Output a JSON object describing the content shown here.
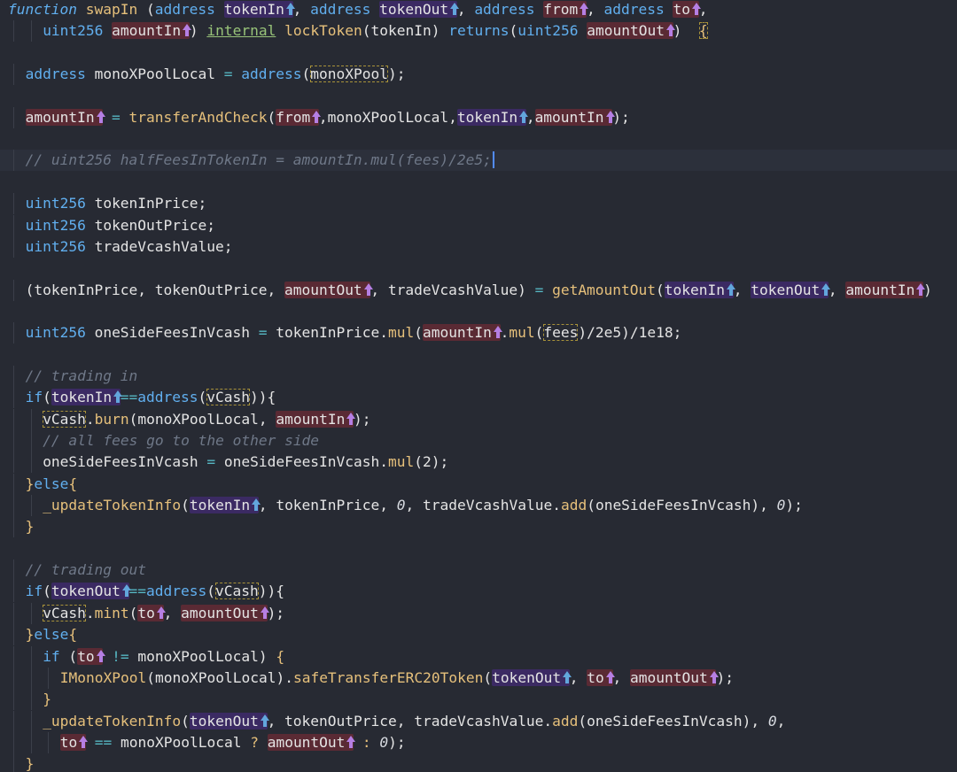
{
  "editor": {
    "lines": [
      {
        "spans": [
          {
            "t": "function",
            "c": "fnkw"
          },
          {
            "t": " "
          },
          {
            "t": "swapIn",
            "c": "fn"
          },
          {
            "t": " ("
          },
          {
            "t": "address",
            "c": "kw"
          },
          {
            "t": " "
          },
          {
            "t": "tokenIn",
            "bg": "pt",
            "a": "b"
          },
          {
            "t": ", "
          },
          {
            "t": "address",
            "c": "kw"
          },
          {
            "t": " "
          },
          {
            "t": "tokenOut",
            "bg": "pt",
            "a": "b"
          },
          {
            "t": ", "
          },
          {
            "t": "address",
            "c": "kw"
          },
          {
            "t": " "
          },
          {
            "t": "from",
            "bg": "pr",
            "a": "p"
          },
          {
            "t": ", "
          },
          {
            "t": "address",
            "c": "kw"
          },
          {
            "t": " "
          },
          {
            "t": "to",
            "bg": "pr",
            "a": "p"
          },
          {
            "t": ","
          }
        ]
      },
      {
        "indent": 2,
        "spans": [
          {
            "t": "uint256",
            "c": "kw"
          },
          {
            "t": " "
          },
          {
            "t": "amountIn",
            "bg": "pr",
            "a": "p"
          },
          {
            "t": ") "
          },
          {
            "t": "internal",
            "c": "vis"
          },
          {
            "t": " "
          },
          {
            "t": "lockToken",
            "c": "fn"
          },
          {
            "t": "(tokenIn) "
          },
          {
            "t": "returns",
            "c": "kw"
          },
          {
            "t": "("
          },
          {
            "t": "uint256",
            "c": "kw"
          },
          {
            "t": " "
          },
          {
            "t": "amountOut",
            "bg": "pr",
            "a": "p"
          },
          {
            "t": ")  "
          },
          {
            "t": "{",
            "c": "fn",
            "box": true
          }
        ]
      },
      {
        "spans": []
      },
      {
        "indent": 1,
        "spans": [
          {
            "t": "address",
            "c": "kw"
          },
          {
            "t": " monoXPoolLocal "
          },
          {
            "t": "=",
            "c": "op"
          },
          {
            "t": " "
          },
          {
            "t": "address",
            "c": "kw"
          },
          {
            "t": "("
          },
          {
            "t": "monoXPool",
            "box": true
          },
          {
            "t": ");"
          }
        ]
      },
      {
        "spans": []
      },
      {
        "indent": 1,
        "spans": [
          {
            "t": "amountIn",
            "bg": "pr",
            "a": "p"
          },
          {
            "t": " "
          },
          {
            "t": "=",
            "c": "op"
          },
          {
            "t": " "
          },
          {
            "t": "transferAndCheck",
            "c": "fn"
          },
          {
            "t": "("
          },
          {
            "t": "from",
            "bg": "pr",
            "a": "p"
          },
          {
            "t": ",monoXPoolLocal,"
          },
          {
            "t": "tokenIn",
            "bg": "pt",
            "a": "b"
          },
          {
            "t": ","
          },
          {
            "t": "amountIn",
            "bg": "pr",
            "a": "p"
          },
          {
            "t": ");"
          }
        ]
      },
      {
        "spans": []
      },
      {
        "indent": 1,
        "active": true,
        "cursor": true,
        "spans": [
          {
            "t": "// uint256 halfFeesInTokenIn = amountIn.mul(fees)/2e5;",
            "c": "cm"
          }
        ]
      },
      {
        "spans": []
      },
      {
        "indent": 1,
        "spans": [
          {
            "t": "uint256",
            "c": "kw"
          },
          {
            "t": " tokenInPrice;"
          }
        ]
      },
      {
        "indent": 1,
        "spans": [
          {
            "t": "uint256",
            "c": "kw"
          },
          {
            "t": " tokenOutPrice;"
          }
        ]
      },
      {
        "indent": 1,
        "spans": [
          {
            "t": "uint256",
            "c": "kw"
          },
          {
            "t": " tradeVcashValue;"
          }
        ]
      },
      {
        "spans": []
      },
      {
        "indent": 1,
        "spans": [
          {
            "t": "(tokenInPrice, tokenOutPrice, "
          },
          {
            "t": "amountOut",
            "bg": "pr",
            "a": "p"
          },
          {
            "t": ", tradeVcashValue) "
          },
          {
            "t": "=",
            "c": "op"
          },
          {
            "t": " "
          },
          {
            "t": "getAmountOut",
            "c": "fn"
          },
          {
            "t": "("
          },
          {
            "t": "tokenIn",
            "bg": "pt",
            "a": "b"
          },
          {
            "t": ", "
          },
          {
            "t": "tokenOut",
            "bg": "pt",
            "a": "b"
          },
          {
            "t": ", "
          },
          {
            "t": "amountIn",
            "bg": "pr",
            "a": "p"
          },
          {
            "t": ")"
          }
        ]
      },
      {
        "spans": []
      },
      {
        "indent": 1,
        "spans": [
          {
            "t": "uint256",
            "c": "kw"
          },
          {
            "t": " oneSideFeesInVcash "
          },
          {
            "t": "=",
            "c": "op"
          },
          {
            "t": " tokenInPrice."
          },
          {
            "t": "mul",
            "c": "fn"
          },
          {
            "t": "("
          },
          {
            "t": "amountIn",
            "bg": "pr",
            "a": "p"
          },
          {
            "t": "."
          },
          {
            "t": "mul",
            "c": "fn"
          },
          {
            "t": "("
          },
          {
            "t": "fees",
            "box": true
          },
          {
            "t": ")/2e5)/1e18;"
          }
        ]
      },
      {
        "spans": []
      },
      {
        "indent": 1,
        "spans": [
          {
            "t": "// trading in",
            "c": "cm"
          }
        ]
      },
      {
        "indent": 1,
        "spans": [
          {
            "t": "if",
            "c": "kw"
          },
          {
            "t": "("
          },
          {
            "t": "tokenIn",
            "bg": "pt",
            "a": "b"
          },
          {
            "t": "==",
            "c": "op"
          },
          {
            "t": "address",
            "c": "kw"
          },
          {
            "t": "("
          },
          {
            "t": "vCash",
            "box": true
          },
          {
            "t": ")){"
          }
        ]
      },
      {
        "indent": 2,
        "spans": [
          {
            "t": "vCash",
            "box": true
          },
          {
            "t": "."
          },
          {
            "t": "burn",
            "c": "fn"
          },
          {
            "t": "(monoXPoolLocal, "
          },
          {
            "t": "amountIn",
            "bg": "pr",
            "a": "p"
          },
          {
            "t": ");"
          }
        ]
      },
      {
        "indent": 2,
        "spans": [
          {
            "t": "// all fees go to the other side",
            "c": "cm"
          }
        ]
      },
      {
        "indent": 2,
        "spans": [
          {
            "t": "oneSideFeesInVcash "
          },
          {
            "t": "=",
            "c": "op"
          },
          {
            "t": " oneSideFeesInVcash."
          },
          {
            "t": "mul",
            "c": "fn"
          },
          {
            "t": "(2);"
          }
        ]
      },
      {
        "indent": 1,
        "spans": [
          {
            "t": "}",
            "c": "fn"
          },
          {
            "t": "else",
            "c": "kw"
          },
          {
            "t": "{",
            "c": "fn"
          }
        ]
      },
      {
        "indent": 2,
        "spans": [
          {
            "t": "_updateTokenInfo",
            "c": "fn"
          },
          {
            "t": "("
          },
          {
            "t": "tokenIn",
            "bg": "pt",
            "a": "b"
          },
          {
            "t": ", tokenInPrice, "
          },
          {
            "t": "0",
            "c": "num"
          },
          {
            "t": ", tradeVcashValue."
          },
          {
            "t": "add",
            "c": "fn"
          },
          {
            "t": "(oneSideFeesInVcash), "
          },
          {
            "t": "0",
            "c": "num"
          },
          {
            "t": ");"
          }
        ]
      },
      {
        "indent": 1,
        "spans": [
          {
            "t": "}",
            "c": "fn"
          }
        ]
      },
      {
        "spans": []
      },
      {
        "indent": 1,
        "spans": [
          {
            "t": "// trading out",
            "c": "cm"
          }
        ]
      },
      {
        "indent": 1,
        "spans": [
          {
            "t": "if",
            "c": "kw"
          },
          {
            "t": "("
          },
          {
            "t": "tokenOut",
            "bg": "pt",
            "a": "b"
          },
          {
            "t": "==",
            "c": "op"
          },
          {
            "t": "address",
            "c": "kw"
          },
          {
            "t": "("
          },
          {
            "t": "vCash",
            "box": true
          },
          {
            "t": ")){"
          }
        ]
      },
      {
        "indent": 2,
        "spans": [
          {
            "t": "vCash",
            "box": true
          },
          {
            "t": "."
          },
          {
            "t": "mint",
            "c": "fn"
          },
          {
            "t": "("
          },
          {
            "t": "to",
            "bg": "pr",
            "a": "p"
          },
          {
            "t": ", "
          },
          {
            "t": "amountOut",
            "bg": "pr",
            "a": "p"
          },
          {
            "t": ");"
          }
        ]
      },
      {
        "indent": 1,
        "spans": [
          {
            "t": "}",
            "c": "fn"
          },
          {
            "t": "else",
            "c": "kw"
          },
          {
            "t": "{",
            "c": "fn"
          }
        ]
      },
      {
        "indent": 2,
        "spans": [
          {
            "t": "if",
            "c": "kw"
          },
          {
            "t": " ("
          },
          {
            "t": "to",
            "bg": "pr",
            "a": "p"
          },
          {
            "t": " "
          },
          {
            "t": "!=",
            "c": "op"
          },
          {
            "t": " monoXPoolLocal) "
          },
          {
            "t": "{",
            "c": "fn"
          }
        ]
      },
      {
        "indent": 3,
        "spans": [
          {
            "t": "IMonoXPool",
            "c": "fn"
          },
          {
            "t": "(monoXPoolLocal)."
          },
          {
            "t": "safeTransferERC20Token",
            "c": "fn"
          },
          {
            "t": "("
          },
          {
            "t": "tokenOut",
            "bg": "pt",
            "a": "b"
          },
          {
            "t": ", "
          },
          {
            "t": "to",
            "bg": "pr",
            "a": "p"
          },
          {
            "t": ", "
          },
          {
            "t": "amountOut",
            "bg": "pr",
            "a": "p"
          },
          {
            "t": ");"
          }
        ]
      },
      {
        "indent": 2,
        "spans": [
          {
            "t": "}",
            "c": "fn"
          }
        ]
      },
      {
        "indent": 2,
        "spans": [
          {
            "t": "_updateTokenInfo",
            "c": "fn"
          },
          {
            "t": "("
          },
          {
            "t": "tokenOut",
            "bg": "pt",
            "a": "b"
          },
          {
            "t": ", tokenOutPrice, tradeVcashValue."
          },
          {
            "t": "add",
            "c": "fn"
          },
          {
            "t": "(oneSideFeesInVcash), "
          },
          {
            "t": "0",
            "c": "num"
          },
          {
            "t": ","
          }
        ]
      },
      {
        "indent": 3,
        "spans": [
          {
            "t": "to",
            "bg": "pr",
            "a": "p"
          },
          {
            "t": " "
          },
          {
            "t": "==",
            "c": "op"
          },
          {
            "t": " monoXPoolLocal "
          },
          {
            "t": "?",
            "c": "fn"
          },
          {
            "t": " "
          },
          {
            "t": "amountOut",
            "bg": "pr",
            "a": "p"
          },
          {
            "t": " "
          },
          {
            "t": ":",
            "c": "fn"
          },
          {
            "t": " "
          },
          {
            "t": "0",
            "c": "num"
          },
          {
            "t": ");"
          }
        ]
      },
      {
        "indent": 1,
        "spans": [
          {
            "t": "}",
            "c": "fn"
          }
        ]
      }
    ]
  }
}
